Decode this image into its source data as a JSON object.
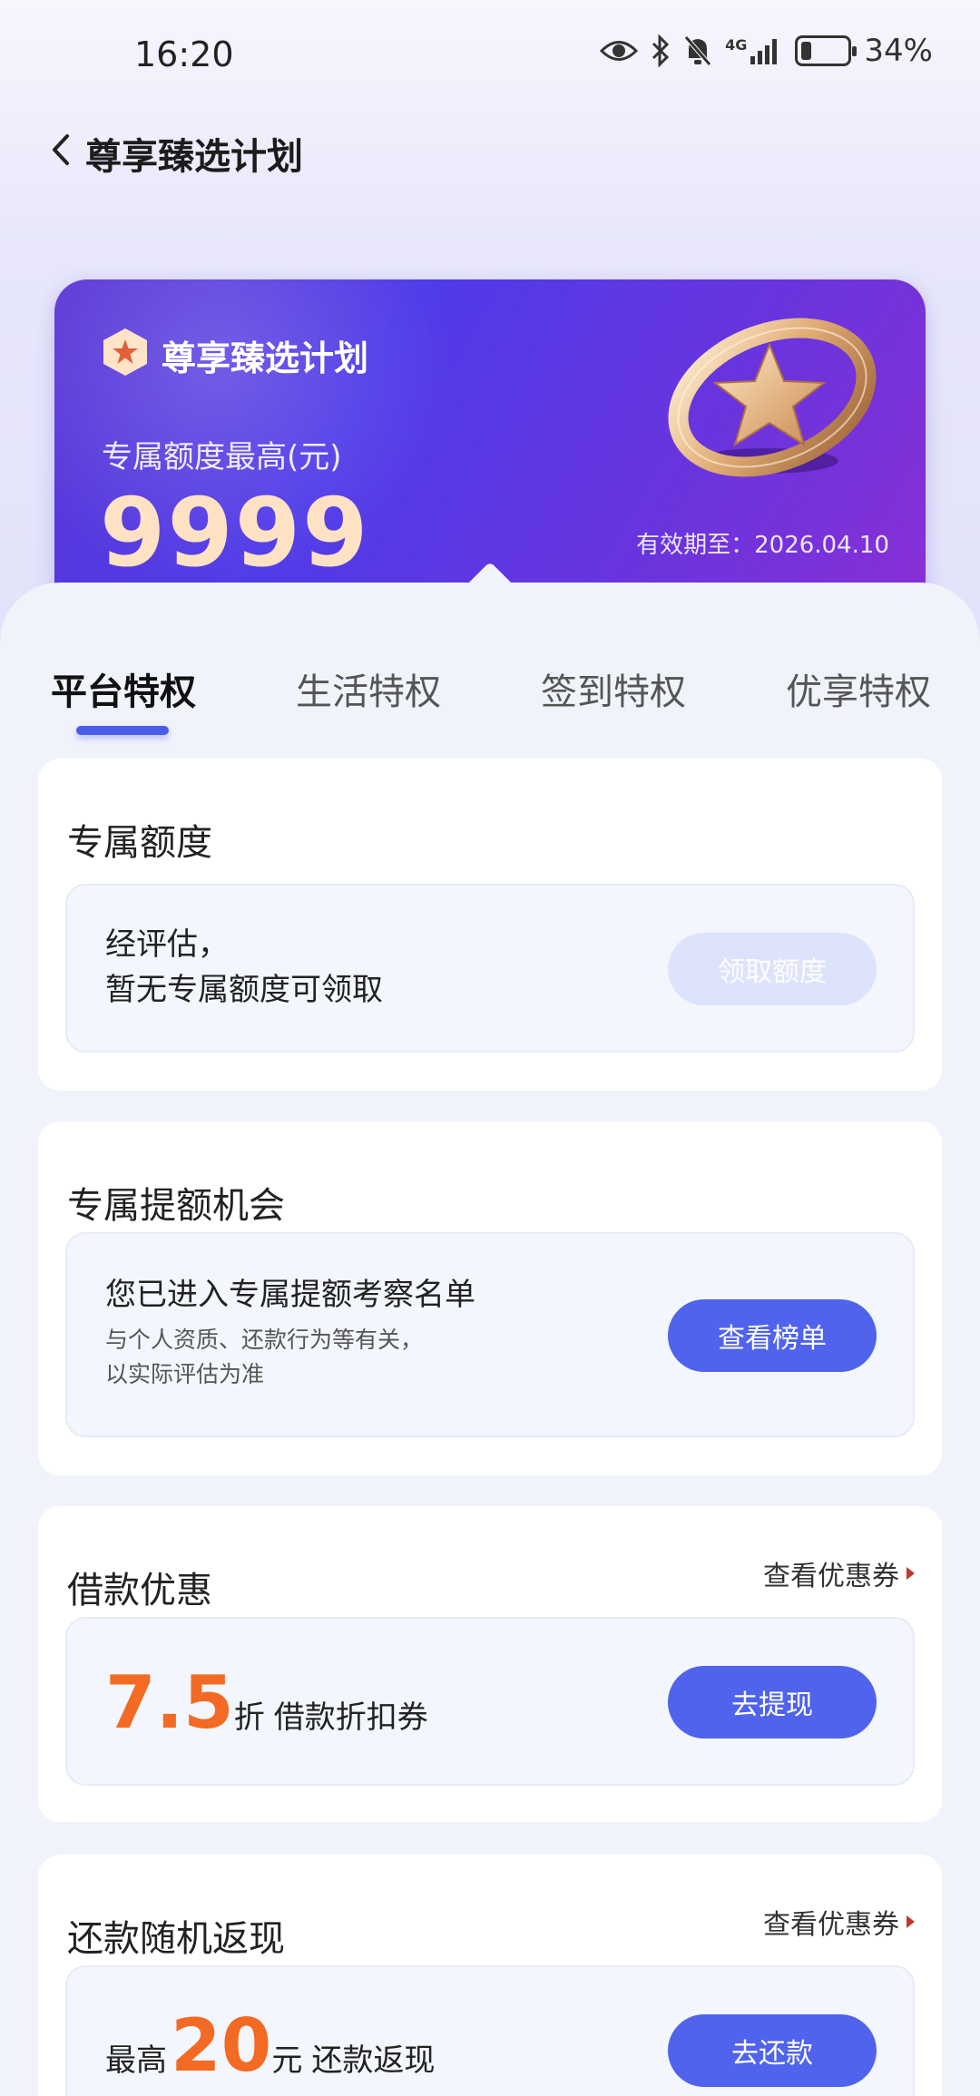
{
  "status_bar": {
    "time": "16:20",
    "network": "4G",
    "battery_percent": "34%",
    "battery_level": 0.34,
    "icons": [
      "eye-icon",
      "bluetooth-icon",
      "bell-muted-icon",
      "signal-icon",
      "battery-icon"
    ]
  },
  "nav": {
    "title": "尊享臻选计划"
  },
  "card": {
    "title": "尊享臻选计划",
    "amount_label": "专属额度最高(元)",
    "amount": "9999",
    "validity": "有效期至：2026.04.10"
  },
  "tabs": [
    {
      "label": "平台特权",
      "active": true
    },
    {
      "label": "生活特权",
      "active": false
    },
    {
      "label": "签到特权",
      "active": false
    },
    {
      "label": "优享特权",
      "active": false
    }
  ],
  "sections": {
    "quota": {
      "title": "专属额度",
      "line1": "经评估，",
      "line2": "暂无专属额度可领取",
      "button": "领取额度"
    },
    "increase": {
      "title": "专属提额机会",
      "main": "您已进入专属提额考察名单",
      "sub1": "与个人资质、还款行为等有关，",
      "sub2": "以实际评估为准",
      "button": "查看榜单"
    },
    "loan": {
      "title": "借款优惠",
      "link": "查看优惠券",
      "number": "7.5",
      "unit": "折",
      "desc": "借款折扣券",
      "button": "去提现"
    },
    "cashback": {
      "title": "还款随机返现",
      "link": "查看优惠券",
      "prefix": "最高",
      "number": "20",
      "unit": "元",
      "desc": "还款返现",
      "button": "去还款"
    }
  },
  "colors": {
    "accent": "#4f63ec",
    "orange": "#f26a23",
    "card_gradient_start": "#5a36d6",
    "card_gradient_end": "#8a2fd6",
    "amount": "#ffe2c4"
  }
}
